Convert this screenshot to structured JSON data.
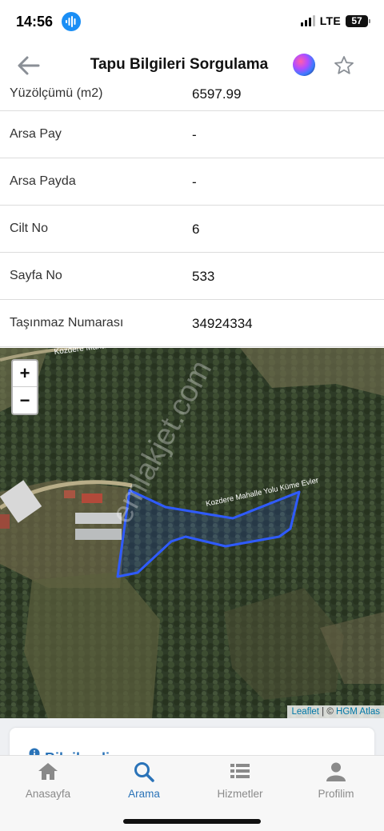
{
  "status_bar": {
    "time": "14:56",
    "network": "LTE",
    "battery": "57"
  },
  "header": {
    "title": "Tapu Bilgileri Sorgulama"
  },
  "rows": [
    {
      "label": "Yüzölçümü (m2)",
      "value": "6597.99"
    },
    {
      "label": "Arsa Pay",
      "value": "-"
    },
    {
      "label": "Arsa Payda",
      "value": "-"
    },
    {
      "label": "Cilt No",
      "value": "6"
    },
    {
      "label": "Sayfa No",
      "value": "533"
    },
    {
      "label": "Taşınmaz Numarası",
      "value": "34924334"
    }
  ],
  "map": {
    "zoom_in": "+",
    "zoom_out": "−",
    "road_label_1": "Kozdere Mahalle Yolu Küme",
    "road_label_2": "Kozdere Mahalle Yolu Küme Evler",
    "road_label_3": "Kozdere Mahalle",
    "attribution_leaflet": "Leaflet",
    "attribution_sep": " | © ",
    "attribution_hgm": "HGM Atlas",
    "watermark": "emlakjet.com",
    "parcel_color": "#2f5bff"
  },
  "info": {
    "title": "Bilgilendirme"
  },
  "tabs": [
    {
      "label": "Anasayfa",
      "icon": "home-icon"
    },
    {
      "label": "Arama",
      "icon": "search-icon"
    },
    {
      "label": "Hizmetler",
      "icon": "list-icon"
    },
    {
      "label": "Profilim",
      "icon": "person-icon"
    }
  ],
  "colors": {
    "accent": "#2a73b8",
    "inactive": "#8a8a8a"
  }
}
